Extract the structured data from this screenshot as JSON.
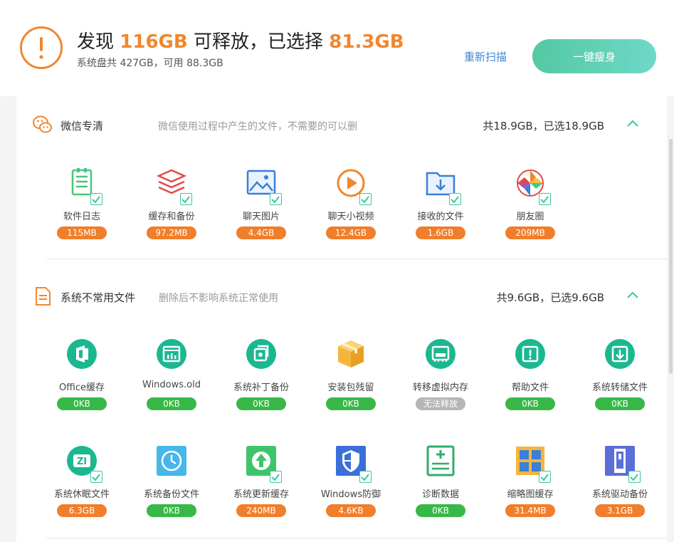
{
  "window": {
    "menu_icon": "menu-icon",
    "minimize_icon": "minimize-icon",
    "back_icon": "back-icon"
  },
  "header": {
    "title_prefix": "发现",
    "found_size": "116GB",
    "title_middle": "可释放，已选择",
    "selected_size": "81.3GB",
    "subtitle": "系统盘共 427GB，可用 88.3GB",
    "rescan_label": "重新扫描",
    "slim_button_label": "一键瘦身",
    "accent_color": "#f0872d",
    "button_color": "#53c9a3"
  },
  "sections": [
    {
      "title": "微信专清",
      "description": "微信使用过程中产生的文件，不需要的可以删",
      "total": "共18.9GB，已选18.9GB",
      "icon": "wechat-icon",
      "items": [
        {
          "label": "软件日志",
          "size": "115MB",
          "icon": "log-icon",
          "status": "orange",
          "checked": true
        },
        {
          "label": "缓存和备份",
          "size": "97.2MB",
          "icon": "layers-icon",
          "status": "orange",
          "checked": true
        },
        {
          "label": "聊天图片",
          "size": "4.4GB",
          "icon": "image-icon",
          "status": "orange",
          "checked": true
        },
        {
          "label": "聊天小视频",
          "size": "12.4GB",
          "icon": "play-icon",
          "status": "orange",
          "checked": true
        },
        {
          "label": "接收的文件",
          "size": "1.6GB",
          "icon": "download-folder-icon",
          "status": "orange",
          "checked": true
        },
        {
          "label": "朋友圈",
          "size": "209MB",
          "icon": "aperture-icon",
          "status": "orange",
          "checked": true
        }
      ]
    },
    {
      "title": "系统不常用文件",
      "description": "删除后不影响系统正常使用",
      "total": "共9.6GB，已选9.6GB",
      "icon": "document-icon",
      "items": [
        {
          "label": "Office缓存",
          "size": "0KB",
          "icon": "office-icon",
          "status": "green",
          "checked": false
        },
        {
          "label": "Windows.old",
          "size": "0KB",
          "icon": "windows-old-icon",
          "status": "green",
          "checked": false
        },
        {
          "label": "系统补丁备份",
          "size": "0KB",
          "icon": "patch-icon",
          "status": "green",
          "checked": false
        },
        {
          "label": "安装包残留",
          "size": "0KB",
          "icon": "package-icon",
          "status": "green",
          "checked": false
        },
        {
          "label": "转移虚拟内存",
          "size": "无法释放",
          "icon": "memory-icon",
          "status": "gray",
          "checked": false
        },
        {
          "label": "帮助文件",
          "size": "0KB",
          "icon": "help-icon",
          "status": "green",
          "checked": false
        },
        {
          "label": "系统转储文件",
          "size": "0KB",
          "icon": "dump-icon",
          "status": "green",
          "checked": false
        },
        {
          "label": "系统休眠文件",
          "size": "6.3GB",
          "icon": "hibernate-icon",
          "status": "orange",
          "checked": true
        },
        {
          "label": "系统备份文件",
          "size": "0KB",
          "icon": "backup-clock-icon",
          "status": "green",
          "checked": false
        },
        {
          "label": "系统更新缓存",
          "size": "240MB",
          "icon": "update-icon",
          "status": "orange",
          "checked": true
        },
        {
          "label": "Windows防御",
          "size": "4.6KB",
          "icon": "shield-icon",
          "status": "orange",
          "checked": true
        },
        {
          "label": "诊断数据",
          "size": "0KB",
          "icon": "diagnostic-icon",
          "status": "green",
          "checked": false
        },
        {
          "label": "缩略图缓存",
          "size": "31.4MB",
          "icon": "thumbnail-icon",
          "status": "orange",
          "checked": true
        },
        {
          "label": "系统驱动备份",
          "size": "3.1GB",
          "icon": "driver-icon",
          "status": "orange",
          "checked": true
        }
      ]
    }
  ]
}
